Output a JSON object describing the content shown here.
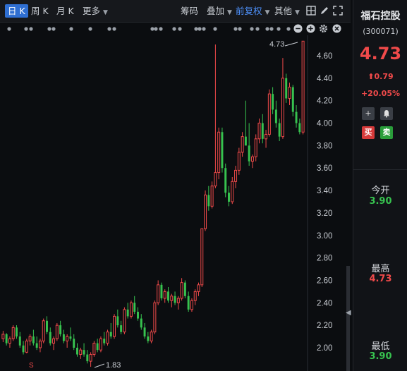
{
  "toolbar": {
    "periods": [
      "日 K",
      "周 K",
      "月 K"
    ],
    "more_label": "更多",
    "chips_label": "筹码",
    "overlay_label": "叠加",
    "adjust_label": "前复权",
    "other_label": "其他"
  },
  "stock": {
    "name": "福石控股",
    "code": "(300071)",
    "price": "4.73",
    "change": "0.79",
    "change_pct": "+20.05%",
    "open_label": "今开",
    "open_value": "3.90",
    "high_label": "最高",
    "high_value": "4.73",
    "low_label": "最低",
    "low_value": "3.90",
    "buy_label": "买",
    "sell_label": "卖"
  },
  "chart_data": {
    "type": "candlestick",
    "y_ticks": [
      "4.60",
      "4.40",
      "4.20",
      "4.00",
      "3.80",
      "3.60",
      "3.40",
      "3.20",
      "3.00",
      "2.80",
      "2.60",
      "2.40",
      "2.20",
      "2.00"
    ],
    "ylim": [
      1.8,
      4.75
    ],
    "annotations": {
      "max_label": "4.73",
      "min_label": "1.83",
      "signal_label": "S"
    },
    "colors": {
      "up": "#f04a4a",
      "down": "#37c24f",
      "background": "#0b0d10"
    },
    "candles": [
      [
        2.08,
        2.15,
        2.05,
        2.12
      ],
      [
        2.12,
        2.13,
        2.02,
        2.04
      ],
      [
        2.04,
        2.1,
        2.0,
        2.08
      ],
      [
        2.08,
        2.2,
        2.06,
        2.18
      ],
      [
        2.18,
        2.2,
        2.08,
        2.1
      ],
      [
        2.1,
        2.14,
        2.0,
        2.02
      ],
      [
        2.02,
        2.06,
        1.94,
        1.96
      ],
      [
        1.96,
        2.08,
        1.95,
        2.06
      ],
      [
        2.06,
        2.12,
        2.02,
        2.1
      ],
      [
        2.1,
        2.16,
        2.02,
        2.04
      ],
      [
        2.04,
        2.1,
        1.98,
        2.0
      ],
      [
        2.0,
        2.08,
        1.96,
        2.06
      ],
      [
        2.06,
        2.26,
        2.04,
        2.24
      ],
      [
        2.24,
        2.28,
        2.12,
        2.14
      ],
      [
        2.14,
        2.18,
        2.02,
        2.04
      ],
      [
        2.04,
        2.1,
        1.98,
        2.08
      ],
      [
        2.08,
        2.22,
        2.06,
        2.2
      ],
      [
        2.2,
        2.24,
        2.1,
        2.12
      ],
      [
        2.12,
        2.16,
        2.04,
        2.06
      ],
      [
        2.06,
        2.12,
        2.0,
        2.1
      ],
      [
        2.1,
        2.18,
        2.06,
        2.08
      ],
      [
        2.08,
        2.12,
        1.98,
        2.0
      ],
      [
        2.0,
        2.04,
        1.92,
        1.94
      ],
      [
        1.94,
        2.0,
        1.9,
        1.98
      ],
      [
        1.98,
        2.04,
        1.92,
        1.94
      ],
      [
        1.94,
        1.98,
        1.86,
        1.88
      ],
      [
        1.88,
        1.96,
        1.83,
        1.94
      ],
      [
        1.94,
        2.06,
        1.92,
        2.04
      ],
      [
        2.04,
        2.08,
        1.96,
        1.98
      ],
      [
        1.98,
        2.1,
        1.96,
        2.08
      ],
      [
        2.08,
        2.14,
        2.02,
        2.04
      ],
      [
        2.04,
        2.16,
        2.02,
        2.14
      ],
      [
        2.14,
        2.22,
        2.08,
        2.1
      ],
      [
        2.1,
        2.3,
        2.08,
        2.28
      ],
      [
        2.28,
        2.34,
        2.18,
        2.2
      ],
      [
        2.2,
        2.24,
        2.12,
        2.14
      ],
      [
        2.14,
        2.36,
        2.12,
        2.34
      ],
      [
        2.34,
        2.4,
        2.26,
        2.28
      ],
      [
        2.28,
        2.42,
        2.26,
        2.4
      ],
      [
        2.4,
        2.46,
        2.3,
        2.32
      ],
      [
        2.32,
        2.36,
        2.24,
        2.26
      ],
      [
        2.26,
        2.3,
        2.16,
        2.18
      ],
      [
        2.18,
        2.22,
        2.08,
        2.1
      ],
      [
        2.1,
        2.14,
        2.04,
        2.06
      ],
      [
        2.06,
        2.16,
        2.04,
        2.14
      ],
      [
        2.14,
        2.42,
        2.12,
        2.4
      ],
      [
        2.4,
        2.6,
        2.38,
        2.56
      ],
      [
        2.56,
        2.58,
        2.42,
        2.44
      ],
      [
        2.44,
        2.52,
        2.4,
        2.5
      ],
      [
        2.5,
        2.54,
        2.4,
        2.42
      ],
      [
        2.42,
        2.48,
        2.36,
        2.46
      ],
      [
        2.46,
        2.5,
        2.38,
        2.4
      ],
      [
        2.4,
        2.46,
        2.34,
        2.44
      ],
      [
        2.44,
        2.62,
        2.42,
        2.58
      ],
      [
        2.58,
        2.6,
        2.44,
        2.46
      ],
      [
        2.46,
        2.5,
        2.32,
        2.34
      ],
      [
        2.34,
        2.44,
        2.32,
        2.42
      ],
      [
        2.42,
        2.52,
        2.38,
        2.5
      ],
      [
        2.5,
        2.58,
        2.46,
        2.56
      ],
      [
        2.56,
        3.06,
        2.54,
        3.06
      ],
      [
        3.06,
        3.4,
        3.04,
        3.36
      ],
      [
        3.36,
        3.44,
        3.22,
        3.26
      ],
      [
        3.26,
        3.48,
        3.24,
        3.44
      ],
      [
        3.44,
        4.7,
        3.42,
        3.56
      ],
      [
        3.56,
        3.96,
        3.5,
        3.92
      ],
      [
        3.92,
        3.96,
        3.56,
        3.6
      ],
      [
        3.6,
        3.64,
        3.34,
        3.38
      ],
      [
        3.38,
        3.44,
        3.26,
        3.3
      ],
      [
        3.3,
        3.52,
        3.28,
        3.48
      ],
      [
        3.48,
        3.62,
        3.42,
        3.58
      ],
      [
        3.58,
        3.78,
        3.54,
        3.74
      ],
      [
        3.74,
        3.92,
        3.7,
        3.88
      ],
      [
        3.88,
        4.2,
        3.84,
        3.8
      ],
      [
        3.8,
        4.0,
        3.62,
        3.66
      ],
      [
        3.66,
        3.72,
        3.6,
        3.7
      ],
      [
        3.7,
        3.9,
        3.66,
        3.86
      ],
      [
        3.86,
        4.04,
        3.82,
        4.0
      ],
      [
        4.0,
        4.08,
        3.82,
        3.86
      ],
      [
        3.86,
        3.94,
        3.78,
        3.9
      ],
      [
        3.9,
        4.3,
        3.88,
        4.26
      ],
      [
        4.26,
        4.32,
        4.08,
        4.12
      ],
      [
        4.12,
        4.2,
        3.96,
        4.0
      ],
      [
        4.0,
        4.04,
        3.84,
        3.88
      ],
      [
        3.88,
        4.58,
        3.86,
        4.4
      ],
      [
        4.4,
        4.44,
        4.18,
        4.22
      ],
      [
        4.22,
        4.36,
        4.16,
        4.32
      ],
      [
        4.32,
        4.34,
        4.06,
        4.1
      ],
      [
        4.1,
        4.16,
        3.96,
        4.0
      ],
      [
        4.0,
        4.04,
        3.9,
        3.92
      ],
      [
        3.92,
        4.73,
        3.9,
        4.73
      ]
    ]
  }
}
